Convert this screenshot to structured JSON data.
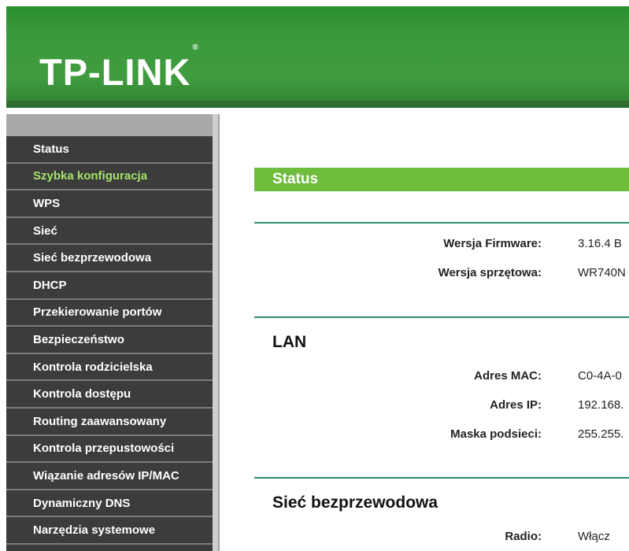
{
  "header": {
    "logo": "TP-LINK",
    "logo_mark": "®"
  },
  "sidebar": {
    "items": [
      {
        "label": "Status",
        "active": false
      },
      {
        "label": "Szybka konfiguracja",
        "active": true
      },
      {
        "label": "WPS",
        "active": false
      },
      {
        "label": "Sieć",
        "active": false
      },
      {
        "label": "Sieć bezprzewodowa",
        "active": false
      },
      {
        "label": "DHCP",
        "active": false
      },
      {
        "label": "Przekierowanie portów",
        "active": false
      },
      {
        "label": "Bezpieczeństwo",
        "active": false
      },
      {
        "label": "Kontrola rodzicielska",
        "active": false
      },
      {
        "label": "Kontrola dostępu",
        "active": false
      },
      {
        "label": "Routing zaawansowany",
        "active": false
      },
      {
        "label": "Kontrola przepustowości",
        "active": false
      },
      {
        "label": "Wiązanie adresów IP/MAC",
        "active": false
      },
      {
        "label": "Dynamiczny DNS",
        "active": false
      },
      {
        "label": "Narzędzia systemowe",
        "active": false
      }
    ]
  },
  "main": {
    "section_title": "Status",
    "firmware": {
      "label": "Wersja Firmware:",
      "value": "3.16.4 B"
    },
    "hardware": {
      "label": "Wersja sprzętowa:",
      "value": "WR740N"
    },
    "lan": {
      "title": "LAN",
      "mac": {
        "label": "Adres MAC:",
        "value": "C0-4A-0"
      },
      "ip": {
        "label": "Adres IP:",
        "value": "192.168."
      },
      "mask": {
        "label": "Maska podsieci:",
        "value": "255.255."
      }
    },
    "wireless": {
      "title": "Sieć bezprzewodowa",
      "radio": {
        "label": "Radio:",
        "value": "Włącz"
      }
    }
  },
  "colors": {
    "header_green": "#3a9a3b",
    "accent_green": "#6ebd3d",
    "active_nav": "#a6e26a",
    "sidebar_bg": "#3c3c3c"
  }
}
